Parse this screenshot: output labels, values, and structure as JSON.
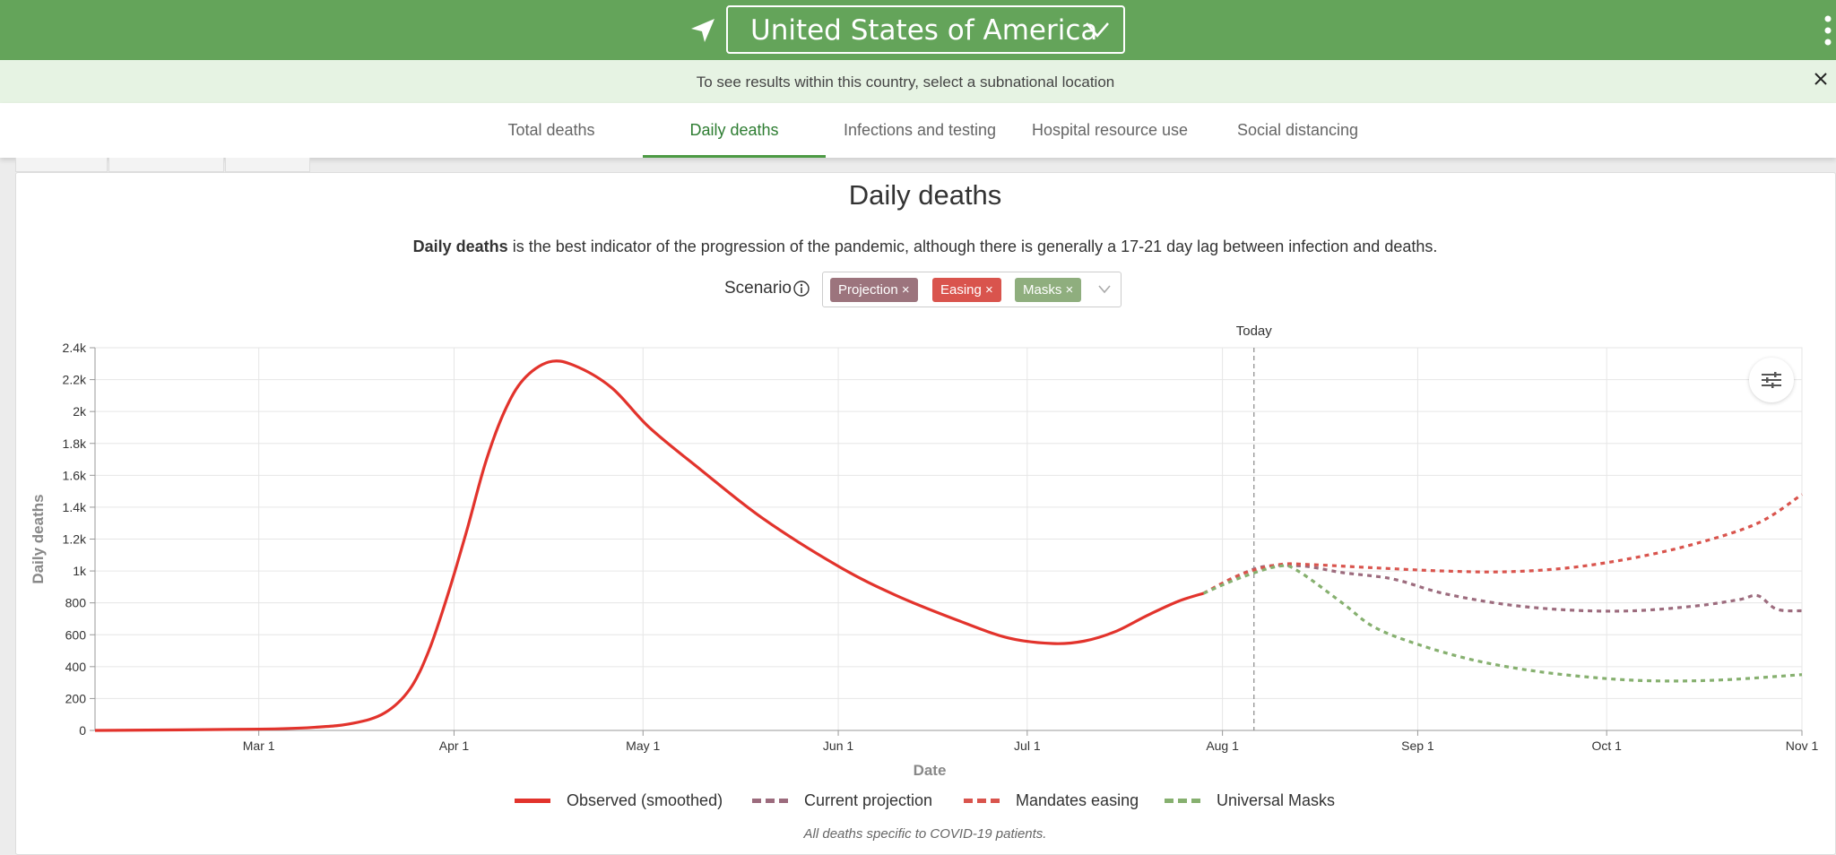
{
  "header": {
    "country": "United States of America",
    "location_icon": "location-arrow-icon",
    "menu_icon": "kebab-menu-icon"
  },
  "banner": {
    "text": "To see results within this country, select a subnational location",
    "close_label": "X"
  },
  "tabs": [
    {
      "label": "Total deaths",
      "active": false
    },
    {
      "label": "Daily deaths",
      "active": true
    },
    {
      "label": "Infections and testing",
      "active": false
    },
    {
      "label": "Hospital resource use",
      "active": false
    },
    {
      "label": "Social distancing",
      "active": false
    }
  ],
  "card": {
    "title": "Daily deaths",
    "desc_bold": "Daily deaths",
    "desc_rest": " is the best indicator of the progression of the pandemic, although there is generally a 17-21 day lag between infection and deaths.",
    "scenario_label": "Scenario",
    "chips": [
      {
        "label": "Projection",
        "color": "#9c747d"
      },
      {
        "label": "Easing",
        "color": "#d9544d"
      },
      {
        "label": "Masks",
        "color": "#8fae7e"
      }
    ],
    "footnote": "All deaths specific to COVID-19 patients."
  },
  "colors": {
    "observed": "#e2332c",
    "projection": "#9c6b7d",
    "easing": "#d9544d",
    "masks": "#86b06f",
    "brand": "#64a45a"
  },
  "chart_data": {
    "type": "line",
    "xlabel": "Date",
    "ylabel": "Daily deaths",
    "x_range": [
      "2020-02-04",
      "2020-11-01"
    ],
    "ylim": [
      0,
      2400
    ],
    "yticks": [
      0,
      200,
      400,
      600,
      800,
      1000,
      1200,
      1400,
      1600,
      1800,
      2000,
      2200,
      2400
    ],
    "ytick_labels": [
      "0",
      "200",
      "400",
      "600",
      "800",
      "1k",
      "1.2k",
      "1.4k",
      "1.6k",
      "1.8k",
      "2k",
      "2.2k",
      "2.4k"
    ],
    "xticks": [
      {
        "date": "2020-03-01",
        "label": "Mar 1"
      },
      {
        "date": "2020-04-01",
        "label": "Apr 1"
      },
      {
        "date": "2020-05-01",
        "label": "May 1"
      },
      {
        "date": "2020-06-01",
        "label": "Jun 1"
      },
      {
        "date": "2020-07-01",
        "label": "Jul 1"
      },
      {
        "date": "2020-08-01",
        "label": "Aug 1"
      },
      {
        "date": "2020-09-01",
        "label": "Sep 1"
      },
      {
        "date": "2020-10-01",
        "label": "Oct 1"
      },
      {
        "date": "2020-11-01",
        "label": "Nov 1"
      }
    ],
    "today": {
      "date": "2020-08-06",
      "label": "Today"
    },
    "grid": true,
    "legend_position": "bottom",
    "series": [
      {
        "name": "Observed (smoothed)",
        "style": "solid",
        "points": [
          [
            "2020-02-04",
            0
          ],
          [
            "2020-03-01",
            8
          ],
          [
            "2020-03-10",
            20
          ],
          [
            "2020-03-16",
            45
          ],
          [
            "2020-03-21",
            110
          ],
          [
            "2020-03-25",
            260
          ],
          [
            "2020-03-28",
            500
          ],
          [
            "2020-03-31",
            850
          ],
          [
            "2020-04-03",
            1250
          ],
          [
            "2020-04-06",
            1680
          ],
          [
            "2020-04-09",
            2000
          ],
          [
            "2020-04-12",
            2200
          ],
          [
            "2020-04-16",
            2310
          ],
          [
            "2020-04-20",
            2290
          ],
          [
            "2020-04-26",
            2150
          ],
          [
            "2020-05-02",
            1900
          ],
          [
            "2020-05-10",
            1640
          ],
          [
            "2020-05-20",
            1330
          ],
          [
            "2020-06-01",
            1030
          ],
          [
            "2020-06-10",
            850
          ],
          [
            "2020-06-20",
            690
          ],
          [
            "2020-06-28",
            580
          ],
          [
            "2020-07-05",
            545
          ],
          [
            "2020-07-10",
            560
          ],
          [
            "2020-07-15",
            620
          ],
          [
            "2020-07-20",
            720
          ],
          [
            "2020-07-25",
            810
          ],
          [
            "2020-07-29",
            860
          ]
        ]
      },
      {
        "name": "Current projection",
        "style": "dashed",
        "points": [
          [
            "2020-07-29",
            860
          ],
          [
            "2020-08-04",
            980
          ],
          [
            "2020-08-08",
            1030
          ],
          [
            "2020-08-14",
            1030
          ],
          [
            "2020-08-20",
            990
          ],
          [
            "2020-08-28",
            950
          ],
          [
            "2020-09-05",
            860
          ],
          [
            "2020-09-15",
            790
          ],
          [
            "2020-09-25",
            755
          ],
          [
            "2020-10-05",
            750
          ],
          [
            "2020-10-15",
            780
          ],
          [
            "2020-10-22",
            820
          ],
          [
            "2020-10-25",
            845
          ],
          [
            "2020-10-28",
            760
          ],
          [
            "2020-11-01",
            750
          ]
        ]
      },
      {
        "name": "Mandates easing",
        "style": "dashed",
        "points": [
          [
            "2020-07-29",
            860
          ],
          [
            "2020-08-04",
            980
          ],
          [
            "2020-08-10",
            1040
          ],
          [
            "2020-08-15",
            1040
          ],
          [
            "2020-08-25",
            1020
          ],
          [
            "2020-09-05",
            1000
          ],
          [
            "2020-09-15",
            995
          ],
          [
            "2020-09-25",
            1020
          ],
          [
            "2020-10-05",
            1080
          ],
          [
            "2020-10-15",
            1170
          ],
          [
            "2020-10-25",
            1300
          ],
          [
            "2020-11-01",
            1480
          ]
        ]
      },
      {
        "name": "Universal Masks",
        "style": "dashed",
        "points": [
          [
            "2020-07-29",
            860
          ],
          [
            "2020-08-04",
            960
          ],
          [
            "2020-08-10",
            1030
          ],
          [
            "2020-08-13",
            1000
          ],
          [
            "2020-08-20",
            800
          ],
          [
            "2020-08-25",
            650
          ],
          [
            "2020-09-01",
            540
          ],
          [
            "2020-09-10",
            440
          ],
          [
            "2020-09-20",
            370
          ],
          [
            "2020-10-01",
            325
          ],
          [
            "2020-10-10",
            310
          ],
          [
            "2020-10-20",
            318
          ],
          [
            "2020-11-01",
            350
          ]
        ]
      }
    ]
  }
}
